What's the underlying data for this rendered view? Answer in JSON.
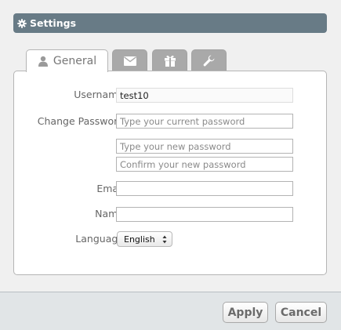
{
  "header": {
    "title": "Settings",
    "icon": "gear-icon"
  },
  "tabs": [
    {
      "label": "General",
      "icon": "user-icon",
      "active": true
    },
    {
      "label": "",
      "icon": "envelope-icon",
      "active": false
    },
    {
      "label": "",
      "icon": "gift-icon",
      "active": false
    },
    {
      "label": "",
      "icon": "wrench-icon",
      "active": false
    }
  ],
  "form": {
    "username_label": "Username",
    "username_value": "test10",
    "change_password_label": "Change Password",
    "current_password_placeholder": "Type your current password",
    "new_password_placeholder": "Type your new password",
    "confirm_password_placeholder": "Confirm your new password",
    "email_label": "Email",
    "email_value": "",
    "name_label": "Name",
    "name_value": "",
    "language_label": "Language",
    "language_value": "English"
  },
  "footer": {
    "apply_label": "Apply",
    "cancel_label": "Cancel"
  },
  "colors": {
    "header_bg": "#687b86",
    "footer_bg": "#e1e5e7",
    "inactive_tab": "#a9a9a9"
  }
}
